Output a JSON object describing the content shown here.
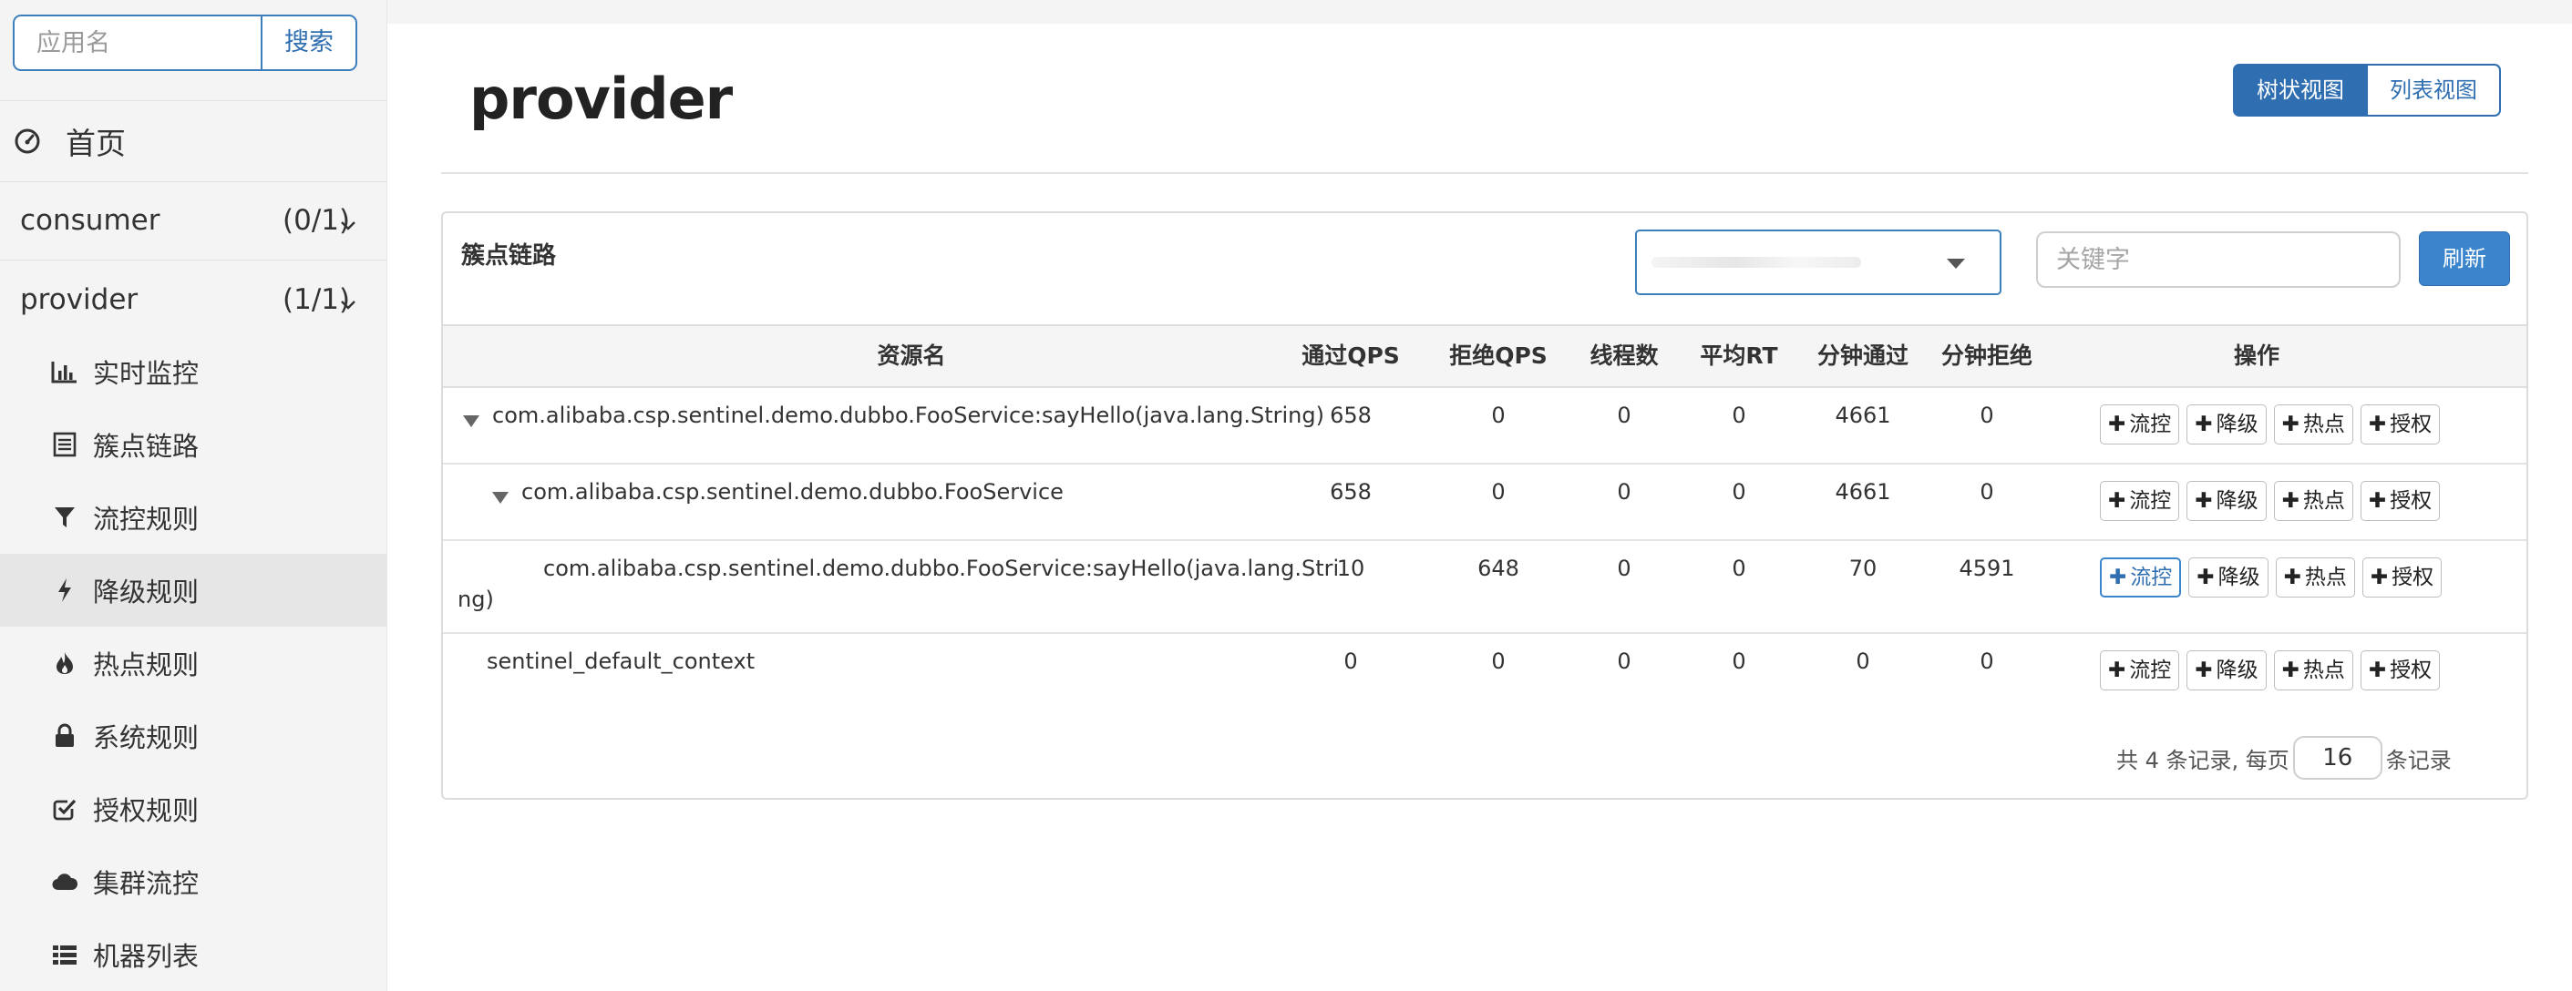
{
  "sidebar": {
    "search_placeholder": "应用名",
    "search_button": "搜索",
    "home_label": "首页",
    "apps": [
      {
        "name": "consumer",
        "count": "(0/1)"
      },
      {
        "name": "provider",
        "count": "(1/1)"
      }
    ],
    "menu": [
      {
        "label": "实时监控",
        "icon": "bar-chart-icon"
      },
      {
        "label": "簇点链路",
        "icon": "list-icon"
      },
      {
        "label": "流控规则",
        "icon": "filter-icon"
      },
      {
        "label": "降级规则",
        "icon": "bolt-icon",
        "active": true
      },
      {
        "label": "热点规则",
        "icon": "fire-icon"
      },
      {
        "label": "系统规则",
        "icon": "lock-icon"
      },
      {
        "label": "授权规则",
        "icon": "check-square-icon"
      },
      {
        "label": "集群流控",
        "icon": "cloud-icon"
      },
      {
        "label": "机器列表",
        "icon": "th-list-icon"
      }
    ]
  },
  "main": {
    "title": "provider",
    "view_toggle": {
      "tree": "树状视图",
      "list": "列表视图"
    },
    "panel_title": "簇点链路",
    "keyword_placeholder": "关键字",
    "refresh_label": "刷新",
    "columns": [
      "资源名",
      "通过QPS",
      "拒绝QPS",
      "线程数",
      "平均RT",
      "分钟通过",
      "分钟拒绝",
      "操作"
    ],
    "rows": [
      {
        "name": "com.alibaba.csp.sentinel.demo.dubbo.FooService:sayHello(java.lang.String)",
        "pass_qps": "658",
        "block_qps": "0",
        "threads": "0",
        "avg_rt": "0",
        "minute_pass": "4661",
        "minute_block": "0"
      },
      {
        "name": "com.alibaba.csp.sentinel.demo.dubbo.FooService",
        "pass_qps": "658",
        "block_qps": "0",
        "threads": "0",
        "avg_rt": "0",
        "minute_pass": "4661",
        "minute_block": "0"
      },
      {
        "name_line1": "com.alibaba.csp.sentinel.demo.dubbo.FooService:sayHello(java.lang.Stri",
        "name_line2": "ng)",
        "pass_qps": "10",
        "block_qps": "648",
        "threads": "0",
        "avg_rt": "0",
        "minute_pass": "70",
        "minute_block": "4591"
      },
      {
        "name": "sentinel_default_context",
        "pass_qps": "0",
        "block_qps": "0",
        "threads": "0",
        "avg_rt": "0",
        "minute_pass": "0",
        "minute_block": "0"
      }
    ],
    "actions": [
      "流控",
      "降级",
      "热点",
      "授权"
    ],
    "pager": {
      "prefix": "共 4 条记录, 每页",
      "page_size": "16",
      "suffix": "条记录"
    }
  },
  "colors": {
    "accent": "#2f6fb1",
    "button_primary": "#3a85cc",
    "sidebar_bg": "#f4f4f4"
  }
}
